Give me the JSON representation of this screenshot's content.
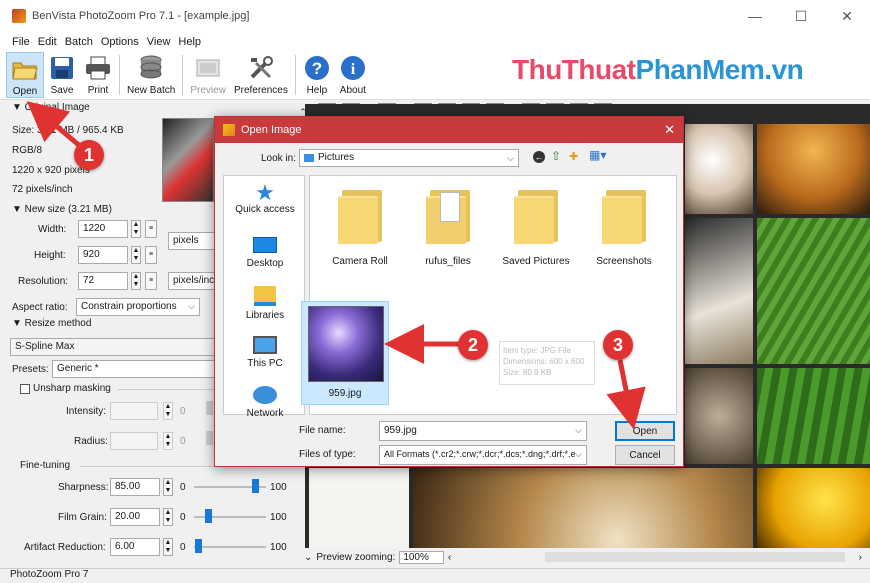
{
  "window": {
    "title": "BenVista PhotoZoom Pro 7.1 - [example.jpg]",
    "min": "—",
    "max": "☐",
    "close": "✕"
  },
  "menu": [
    "File",
    "Edit",
    "Batch",
    "Options",
    "View",
    "Help"
  ],
  "toolbar": {
    "open": "Open",
    "save": "Save",
    "print": "Print",
    "new_batch": "New Batch",
    "preview": "Preview",
    "preferences": "Preferences",
    "help": "Help",
    "about": "About"
  },
  "brand": {
    "part1": "ThuThuat",
    "part2": "PhanMem.vn"
  },
  "original": {
    "header": "▼ Original Image",
    "size": "Size: 3.21 MB / 965.4 KB",
    "mode": "RGB/8",
    "pixels": "1220 x 920 pixels",
    "ppi": "72 pixels/inch"
  },
  "newsize": {
    "header": "▼ New size (3.21 MB)",
    "width_label": "Width:",
    "width": "1220",
    "height_label": "Height:",
    "height": "920",
    "resolution_label": "Resolution:",
    "resolution": "72",
    "unit": "pixels",
    "res_unit": "pixels/inch",
    "aspect_label": "Aspect ratio:",
    "aspect": "Constrain proportions"
  },
  "resize": {
    "header": "▼ Resize method",
    "method": "S-Spline Max",
    "presets_label": "Presets:",
    "preset": "Generic *",
    "unsharp": "Unsharp masking",
    "intensity": "Intensity:",
    "radius": "Radius:",
    "zero": "0"
  },
  "finetune": {
    "header": "Fine-tuning",
    "sharpness_label": "Sharpness:",
    "sharpness": "85.00",
    "film_grain_label": "Film Grain:",
    "film_grain": "20.00",
    "artifact_label": "Artifact Reduction:",
    "artifact": "6.00",
    "min": "0",
    "max": "100",
    "sharpness_level": 0.85,
    "film_grain_level": 0.2,
    "artifact_level": 0.06
  },
  "preview_zoom": {
    "label": "Preview zooming:",
    "value": "100%"
  },
  "status": "PhotoZoom Pro 7",
  "dialog": {
    "title": "Open Image",
    "close": "✕",
    "lookin_label": "Look in:",
    "lookin_value": "Pictures",
    "places": [
      "Quick access",
      "Desktop",
      "Libraries",
      "This PC",
      "Network"
    ],
    "folders": [
      "Camera Roll",
      "rufus_files",
      "Saved Pictures",
      "Screenshots"
    ],
    "file": "959.jpg",
    "ghost_tooltip": [
      "Item type: JPG File",
      "Dimensions: 600 x 600",
      "Size: 80.9 KB"
    ],
    "filename_label": "File name:",
    "filename_value": "959.jpg",
    "filetype_label": "Files of type:",
    "filetype_value": "All Formats (*.cr2;*.crw;*.dcr;*.dcs;*.dng;*.drf;*.e",
    "open_button": "Open",
    "cancel_button": "Cancel"
  },
  "markers": [
    "1",
    "2",
    "3"
  ],
  "colors": {
    "accent_red": "#e03232",
    "dialog_title": "#c83a3c",
    "brand_pink": "#e84a6a",
    "brand_blue": "#2a94d6"
  }
}
